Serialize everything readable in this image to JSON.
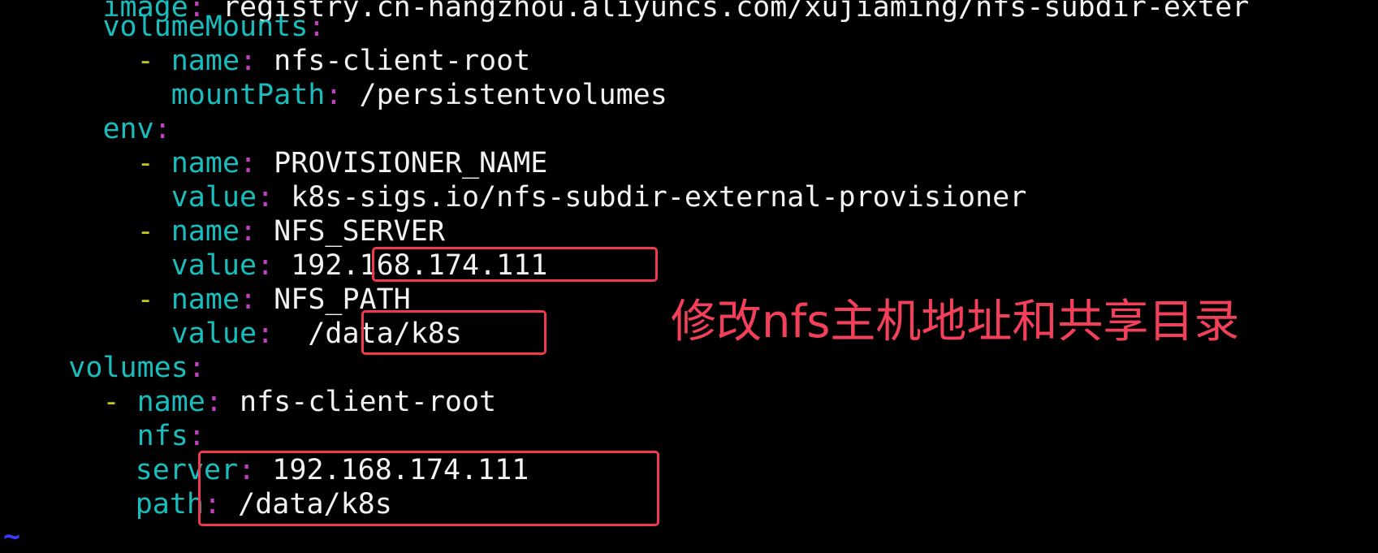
{
  "editor": {
    "lines": [
      {
        "pre": "      ",
        "dash": "",
        "key": "image",
        "colon": ":",
        "value": " registry.cn-hangzhou.aliyuncs.com/xujiaming/nfs-subdir-exter"
      },
      {
        "pre": "      ",
        "dash": "",
        "key": "volumeMounts",
        "colon": ":",
        "value": ""
      },
      {
        "pre": "        ",
        "dash": "- ",
        "key": "name",
        "colon": ":",
        "value": " nfs-client-root"
      },
      {
        "pre": "          ",
        "dash": "",
        "key": "mountPath",
        "colon": ":",
        "value": " /persistentvolumes"
      },
      {
        "pre": "      ",
        "dash": "",
        "key": "env",
        "colon": ":",
        "value": ""
      },
      {
        "pre": "        ",
        "dash": "- ",
        "key": "name",
        "colon": ":",
        "value": " PROVISIONER_NAME"
      },
      {
        "pre": "          ",
        "dash": "",
        "key": "value",
        "colon": ":",
        "value": " k8s-sigs.io/nfs-subdir-external-provisioner"
      },
      {
        "pre": "        ",
        "dash": "- ",
        "key": "name",
        "colon": ":",
        "value": " NFS_SERVER"
      },
      {
        "pre": "          ",
        "dash": "",
        "key": "value",
        "colon": ":",
        "value": " 192.168.174.111"
      },
      {
        "pre": "        ",
        "dash": "- ",
        "key": "name",
        "colon": ":",
        "value": " NFS_PATH"
      },
      {
        "pre": "          ",
        "dash": "",
        "key": "value",
        "colon": ":",
        "value": "  /data/k8s"
      },
      {
        "pre": "    ",
        "dash": "",
        "key": "volumes",
        "colon": ":",
        "value": ""
      },
      {
        "pre": "      ",
        "dash": "- ",
        "key": "name",
        "colon": ":",
        "value": " nfs-client-root"
      },
      {
        "pre": "        ",
        "dash": "",
        "key": "nfs",
        "colon": ":",
        "value": ""
      },
      {
        "pre": "          ",
        "dash": "",
        "key": "server",
        "colon": ":",
        "value": " 192.168.174.111"
      },
      {
        "pre": "          ",
        "dash": "",
        "key": "path",
        "colon": ":",
        "value": " /data/k8s"
      }
    ],
    "tilde": "~"
  },
  "annotation": {
    "text": "修改nfs主机地址和共享目录"
  },
  "colors": {
    "background": "#000000",
    "key": "#19bdbd",
    "colon": "#c03fc0",
    "dash": "#c7c716",
    "value": "#f2f2f2",
    "highlight": "#f0384f",
    "annotation": "#f2405a"
  }
}
